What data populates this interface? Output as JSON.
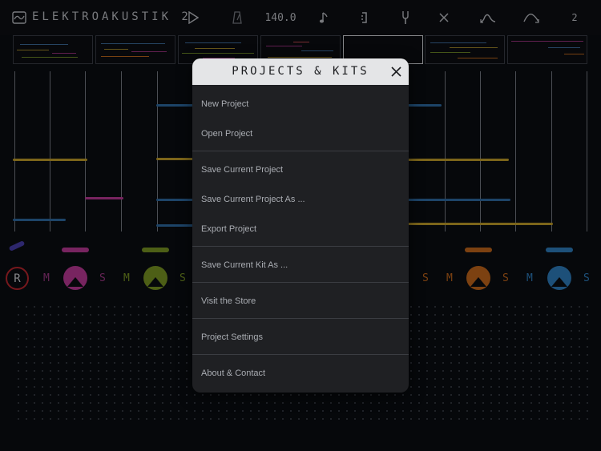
{
  "app": {
    "title": "ELEKTROAKUSTIK 2"
  },
  "toolbar": {
    "tempo": "140.0",
    "page_number": "2",
    "icons": [
      "play-icon",
      "metronome-icon",
      "note-icon",
      "bracket-icon",
      "tuning-fork-icon",
      "close-icon",
      "envelope-curve-icon",
      "ramp-curve-icon"
    ]
  },
  "colors": {
    "yellow": "#c9a42a",
    "blue": "#2f6ea8",
    "magenta": "#c23a9c",
    "green": "#7d9a25",
    "orange": "#c96a1c",
    "sky": "#2f82c4",
    "record": "#c0282f"
  },
  "channels": {
    "record_label": "R",
    "mute_label": "M",
    "solo_label": "S"
  },
  "modal": {
    "title": "PROJECTS & KITS",
    "items": [
      "New Project",
      "Open Project",
      "Save Current Project",
      "Save Current Project As ...",
      "Export Project",
      "Save Current Kit As ...",
      "Visit the Store",
      "Project Settings",
      "About & Contact"
    ]
  }
}
